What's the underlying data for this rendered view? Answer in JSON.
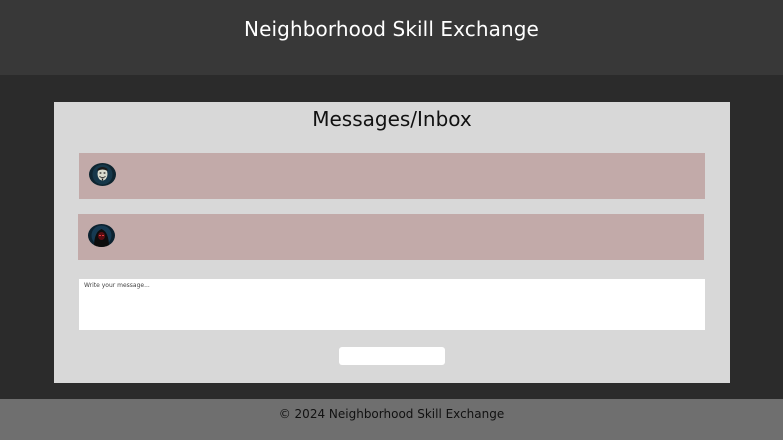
{
  "header": {
    "title": "Neighborhood Skill Exchange"
  },
  "inbox": {
    "title": "Messages/Inbox",
    "messages": [
      {
        "avatar_icon": "anonymous-mask-avatar"
      },
      {
        "avatar_icon": "hooded-figure-avatar"
      }
    ],
    "compose": {
      "placeholder": "Write your message..."
    },
    "send_label": ""
  },
  "footer": {
    "text": "© 2024 Neighborhood Skill Exchange"
  },
  "colors": {
    "header_bg": "#383838",
    "page_bg": "#2b2b2b",
    "panel_bg": "#d8d8d8",
    "message_bg": "#c2aaa9",
    "footer_bg": "#6f6f6f"
  }
}
